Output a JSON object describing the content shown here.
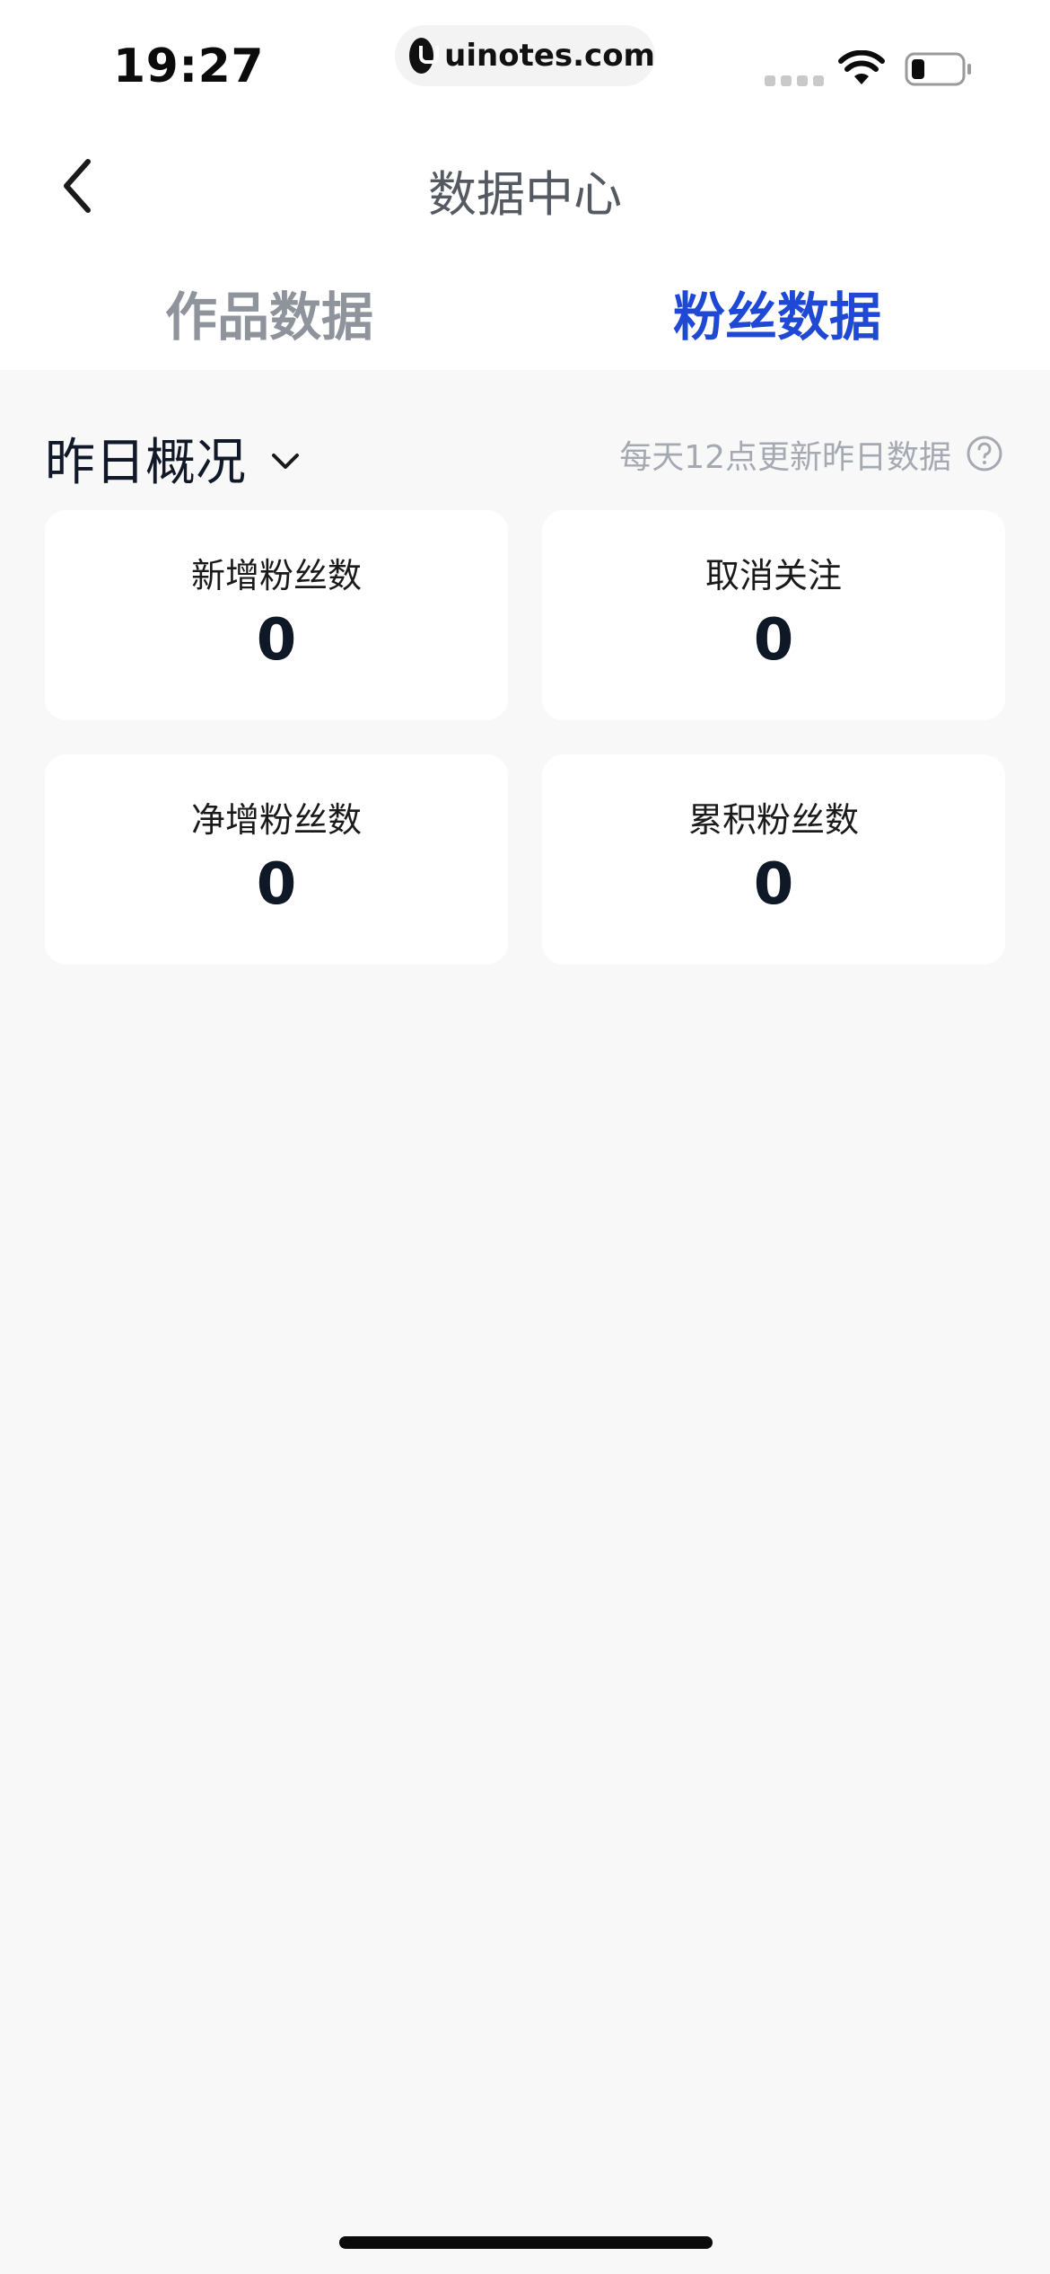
{
  "status_bar": {
    "time": "19:27",
    "url": "uinotes.com"
  },
  "header": {
    "title": "数据中心"
  },
  "tabs": [
    {
      "label": "作品数据",
      "active": false
    },
    {
      "label": "粉丝数据",
      "active": true
    }
  ],
  "section": {
    "title": "昨日概况",
    "update_note": "每天12点更新昨日数据"
  },
  "cards": [
    {
      "label": "新增粉丝数",
      "value": "0"
    },
    {
      "label": "取消关注",
      "value": "0"
    },
    {
      "label": "净增粉丝数",
      "value": "0"
    },
    {
      "label": "累积粉丝数",
      "value": "0"
    }
  ],
  "colors": {
    "accent": "#1f48d4",
    "inactive_tab": "#8e939c",
    "background": "#f8f8f9"
  }
}
